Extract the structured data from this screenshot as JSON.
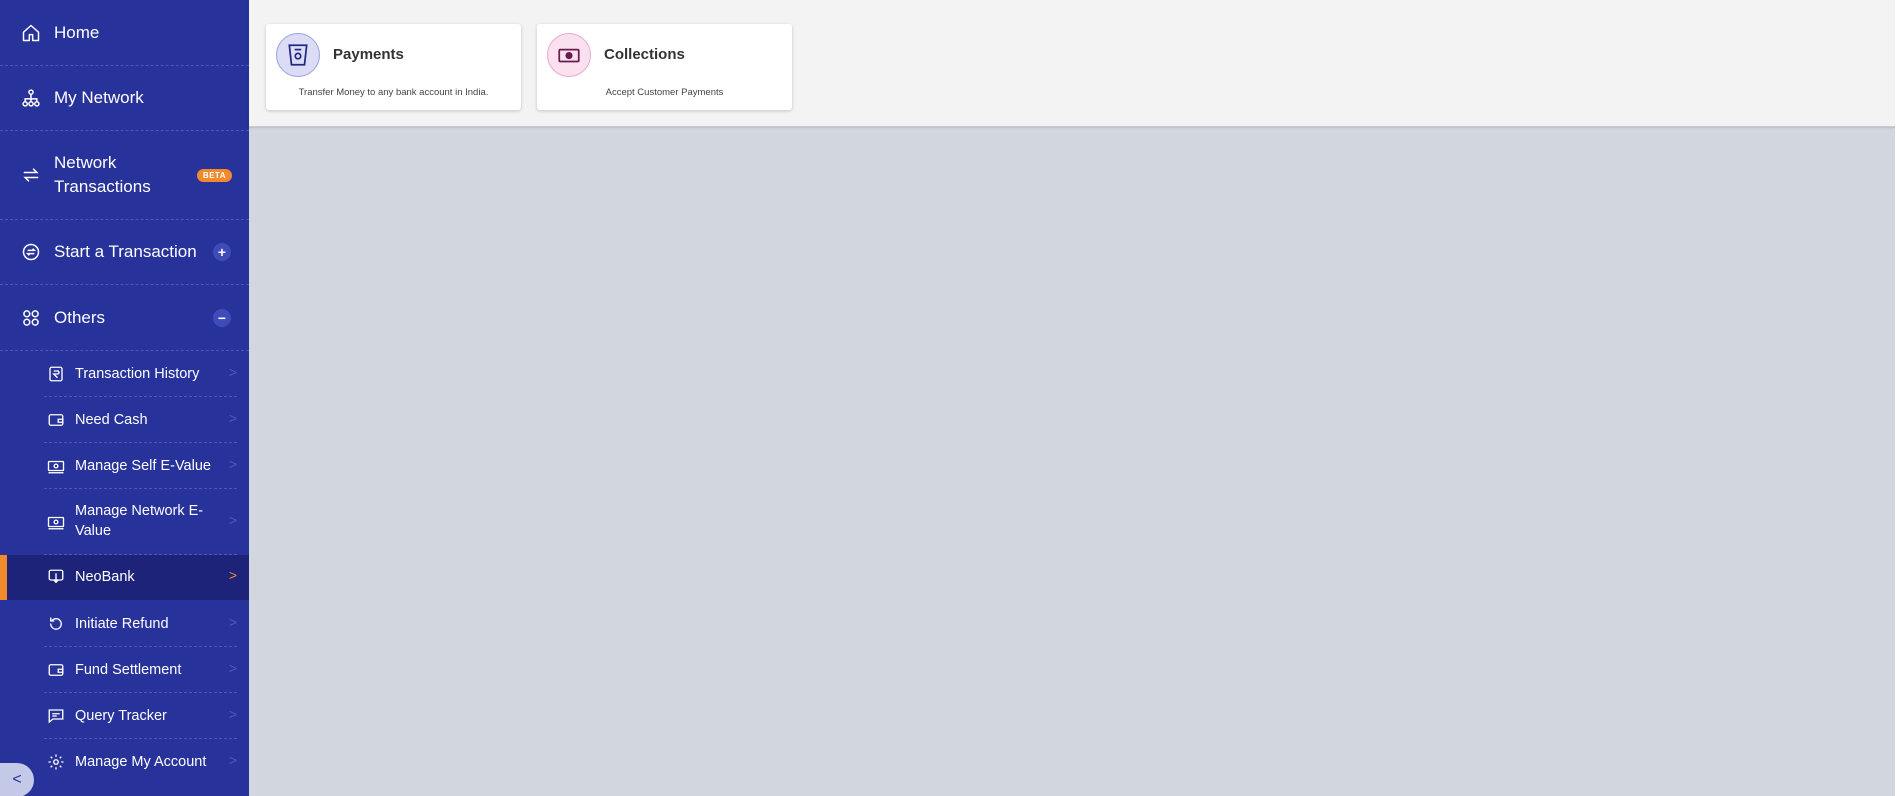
{
  "sidebar": {
    "main_items": [
      {
        "label": "Home",
        "icon": "home-icon"
      },
      {
        "label": "My Network",
        "icon": "network-icon"
      },
      {
        "label": "Network Transactions",
        "icon": "transfer-arrows-icon",
        "badge": "BETA"
      },
      {
        "label": "Start a Transaction",
        "icon": "transaction-icon",
        "action": "+"
      },
      {
        "label": "Others",
        "icon": "apps-grid-icon",
        "action": "−"
      }
    ],
    "sub_items": [
      {
        "label": "Transaction History",
        "icon": "receipt-icon"
      },
      {
        "label": "Need Cash",
        "icon": "wallet-icon"
      },
      {
        "label": "Manage Self E-Value",
        "icon": "cash-icon"
      },
      {
        "label": "Manage Network E-Value",
        "icon": "cash-icon"
      },
      {
        "label": "NeoBank",
        "icon": "neobank-icon",
        "active": true
      },
      {
        "label": "Initiate Refund",
        "icon": "refund-icon"
      },
      {
        "label": "Fund Settlement",
        "icon": "wallet-icon"
      },
      {
        "label": "Query Tracker",
        "icon": "chat-icon"
      },
      {
        "label": "Manage My Account",
        "icon": "gear-icon"
      }
    ]
  },
  "cards": [
    {
      "title": "Payments",
      "description": "Transfer Money to any bank account in India.",
      "icon": "payments-icon"
    },
    {
      "title": "Collections",
      "description": "Accept Customer Payments",
      "icon": "collections-icon"
    }
  ],
  "colors": {
    "sidebar_bg": "#27329a",
    "active_bg": "#1c2379",
    "accent": "#f28a2d",
    "content_bg": "#d2d6df"
  }
}
